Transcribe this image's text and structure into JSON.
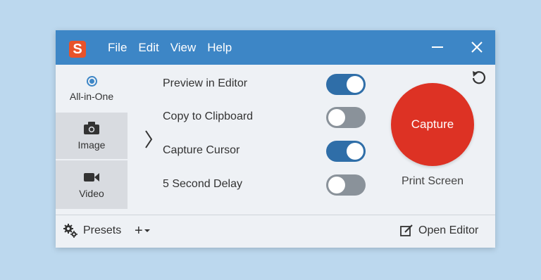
{
  "titlebar": {
    "logo_letter": "S",
    "menu": [
      "File",
      "Edit",
      "View",
      "Help"
    ]
  },
  "modes": [
    {
      "label": "All-in-One",
      "icon": "radio-selected-icon",
      "selected": true
    },
    {
      "label": "Image",
      "icon": "camera-icon",
      "selected": false
    },
    {
      "label": "Video",
      "icon": "video-camera-icon",
      "selected": false
    }
  ],
  "options": [
    {
      "label": "Preview in Editor",
      "on": true
    },
    {
      "label": "Copy to Clipboard",
      "on": false
    },
    {
      "label": "Capture Cursor",
      "on": true
    },
    {
      "label": "5 Second Delay",
      "on": false
    }
  ],
  "capture": {
    "button_label": "Capture",
    "hotkey": "Print Screen",
    "color": "#dd3224"
  },
  "footer": {
    "presets_label": "Presets",
    "add_label": "+",
    "open_editor_label": "Open Editor"
  },
  "colors": {
    "titlebar": "#3d86c6",
    "toggle_on": "#2f6ea8",
    "toggle_off": "#8a929a"
  }
}
